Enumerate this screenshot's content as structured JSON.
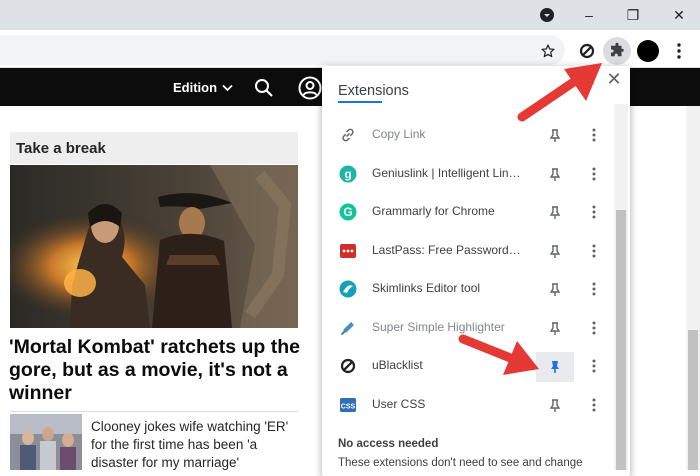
{
  "browser": {
    "window_controls": {
      "minimize": "–",
      "restore": "❐",
      "close": "✕"
    }
  },
  "site": {
    "edition_label": "Edition",
    "section_heading": "Take a break",
    "headline": "'Mortal Kombat' ratchets up the gore, but as a movie, it's not a winner",
    "subheadline": "Clooney jokes wife watching 'ER' for the first time has been 'a disaster for my marriage'"
  },
  "extensions_popup": {
    "title": "Extensions",
    "items": [
      {
        "name": "Copy Link",
        "icon": "link-icon",
        "pinned": false,
        "dim": true
      },
      {
        "name": "Geniuslink | Intelligent Link Management",
        "icon": "geniuslink-icon",
        "pinned": false,
        "dim": false
      },
      {
        "name": "Grammarly for Chrome",
        "icon": "grammarly-icon",
        "pinned": false,
        "dim": false
      },
      {
        "name": "LastPass: Free Password Manager",
        "icon": "lastpass-icon",
        "pinned": false,
        "dim": false
      },
      {
        "name": "Skimlinks Editor tool",
        "icon": "skimlinks-icon",
        "pinned": false,
        "dim": false
      },
      {
        "name": "Super Simple Highlighter",
        "icon": "highlighter-icon",
        "pinned": false,
        "dim": true
      },
      {
        "name": "uBlacklist",
        "icon": "ublacklist-icon",
        "pinned": true,
        "dim": false
      },
      {
        "name": "User CSS",
        "icon": "usercss-icon",
        "pinned": false,
        "dim": false
      }
    ],
    "no_access_title": "No access needed",
    "no_access_desc": "These extensions don't need to see and change"
  },
  "colors": {
    "accent": "#1a73e8",
    "arrow": "#e53935",
    "site_bar": "#0c0c0c"
  }
}
